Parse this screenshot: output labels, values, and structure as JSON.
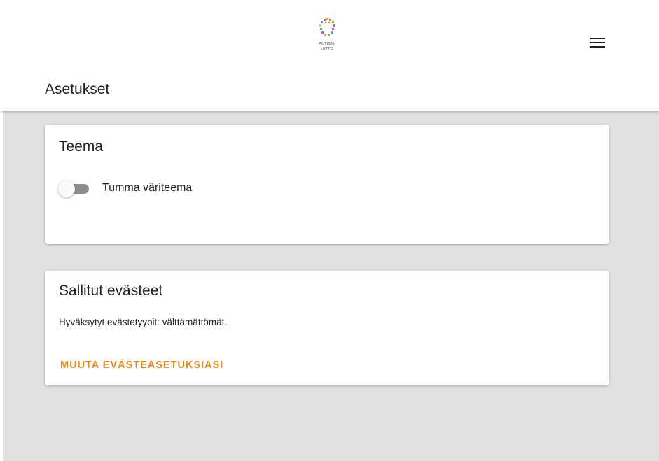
{
  "header": {
    "logo_text_line1": "AUTISMI",
    "logo_text_line2": "LIITTO",
    "menu_icon": "hamburger-menu-icon"
  },
  "page": {
    "title": "Asetukset"
  },
  "theme_card": {
    "title": "Teema",
    "toggle_label": "Tumma väriteema",
    "toggle_on": false
  },
  "cookies_card": {
    "title": "Sallitut evästeet",
    "accepted_text": "Hyväksytyt evästetyypit: välttämättömät.",
    "change_button_label": "MUUTA EVÄSTEASETUKSIASI"
  },
  "colors": {
    "accent": "#e08a1e",
    "background": "#e1e1e0",
    "card": "#ffffff",
    "toggle_track": "#8c8c8c"
  }
}
